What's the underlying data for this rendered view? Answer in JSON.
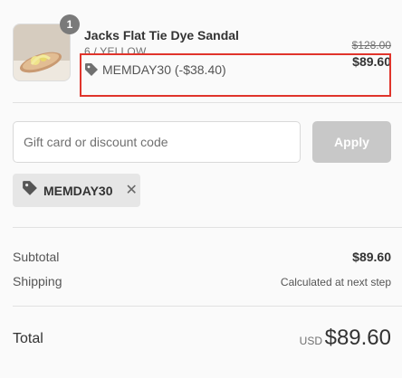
{
  "product": {
    "quantity_badge": "1",
    "name": "Jacks Flat Tie Dye Sandal",
    "variant": "6 / YELLOW",
    "discount_line": "MEMDAY30 (-$38.40)",
    "original_price": "$128.00",
    "price": "$89.60"
  },
  "discount_form": {
    "placeholder": "Gift card or discount code",
    "value": "",
    "apply_label": "Apply"
  },
  "applied_code": {
    "code": "MEMDAY30",
    "remove_glyph": "✕"
  },
  "summary": {
    "subtotal_label": "Subtotal",
    "subtotal_value": "$89.60",
    "shipping_label": "Shipping",
    "shipping_value": "Calculated at next step",
    "total_label": "Total",
    "currency": "USD",
    "total_value": "$89.60"
  },
  "colors": {
    "highlight_border": "#e0342b",
    "apply_button": "#c8c8c8",
    "tag_background": "#e6e6e6"
  }
}
